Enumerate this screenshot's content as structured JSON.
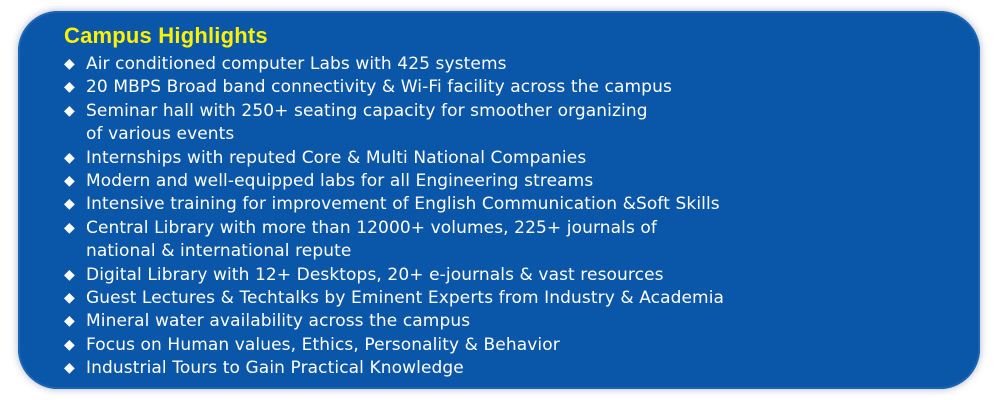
{
  "panel": {
    "title": "Campus Highlights",
    "bullet_glyph": "◆",
    "items": [
      "Air conditioned computer Labs with 425 systems",
      "20 MBPS Broad band connectivity & Wi-Fi facility across the campus",
      "Seminar hall with 250+ seating capacity for smoother organizing\nof various events",
      "Internships with reputed Core & Multi National Companies",
      "Modern and well-equipped labs for all Engineering streams",
      "Intensive training for improvement of English Communication &Soft Skills",
      "Central Library with more than 12000+ volumes,  225+ journals of\nnational & international repute",
      "Digital Library with 12+ Desktops, 20+ e-journals & vast resources",
      "Guest Lectures & Techtalks by Eminent Experts from Industry & Academia",
      "Mineral water availability across the campus",
      "Focus on Human values, Ethics, Personality & Behavior",
      "Industrial Tours to Gain Practical Knowledge"
    ]
  },
  "colors": {
    "panel_background": "#0a56a8",
    "title": "#fff200",
    "text": "#ffffff"
  }
}
